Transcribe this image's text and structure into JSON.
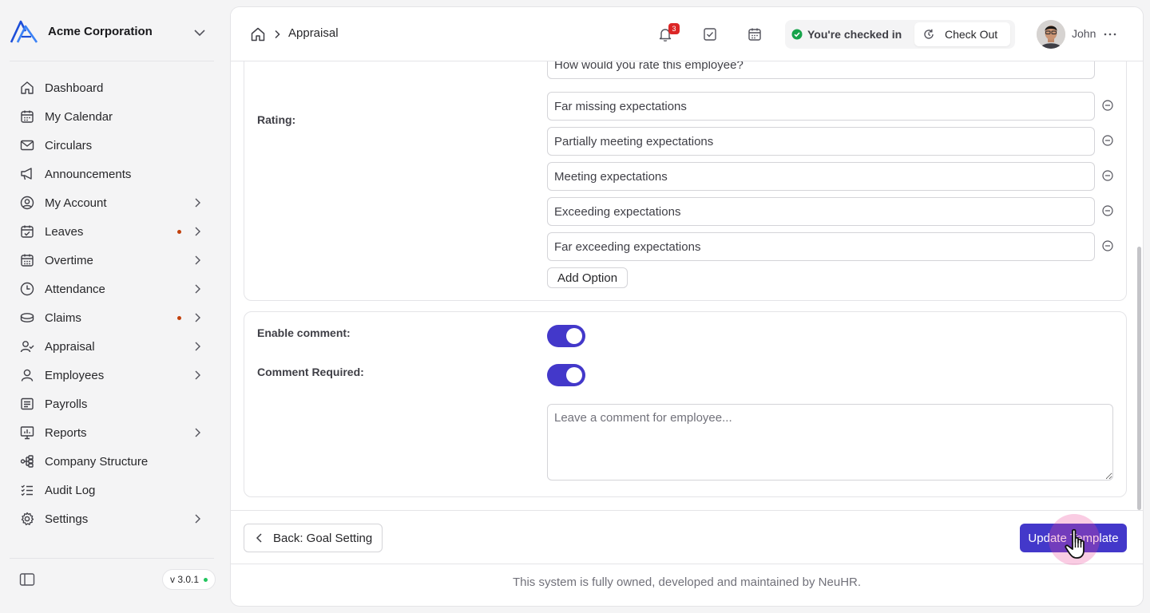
{
  "org": {
    "name": "Acme Corporation"
  },
  "sidebar": {
    "items": [
      {
        "label": "Dashboard",
        "icon": "home-icon",
        "chevron": false,
        "dot": false
      },
      {
        "label": "My Calendar",
        "icon": "calendar-icon",
        "chevron": false,
        "dot": false
      },
      {
        "label": "Circulars",
        "icon": "mail-icon",
        "chevron": false,
        "dot": false
      },
      {
        "label": "Announcements",
        "icon": "megaphone-icon",
        "chevron": false,
        "dot": false
      },
      {
        "label": "My Account",
        "icon": "user-circle-icon",
        "chevron": true,
        "dot": false
      },
      {
        "label": "Leaves",
        "icon": "calendar-check-icon",
        "chevron": true,
        "dot": true
      },
      {
        "label": "Overtime",
        "icon": "calendar-grid-icon",
        "chevron": true,
        "dot": false
      },
      {
        "label": "Attendance",
        "icon": "clock-icon",
        "chevron": true,
        "dot": false
      },
      {
        "label": "Claims",
        "icon": "coins-icon",
        "chevron": true,
        "dot": true
      },
      {
        "label": "Appraisal",
        "icon": "user-check-icon",
        "chevron": true,
        "dot": false
      },
      {
        "label": "Employees",
        "icon": "user-icon",
        "chevron": true,
        "dot": false
      },
      {
        "label": "Payrolls",
        "icon": "receipt-icon",
        "chevron": false,
        "dot": false
      },
      {
        "label": "Reports",
        "icon": "presentation-chart-icon",
        "chevron": true,
        "dot": false
      },
      {
        "label": "Company Structure",
        "icon": "hierarchy-icon",
        "chevron": false,
        "dot": false
      },
      {
        "label": "Audit Log",
        "icon": "checklist-icon",
        "chevron": false,
        "dot": false
      },
      {
        "label": "Settings",
        "icon": "gear-icon",
        "chevron": true,
        "dot": false
      }
    ],
    "version": "v 3.0.1"
  },
  "header": {
    "breadcrumb": "Appraisal",
    "notification_count": "3",
    "check_status": "You're checked in",
    "check_out_label": "Check Out",
    "user_name": "John"
  },
  "form": {
    "question_value": "How would you rate this employee?",
    "rating_label": "Rating:",
    "rating_options": [
      "Far missing expectations",
      "Partially meeting expectations",
      "Meeting expectations",
      "Exceeding expectations",
      "Far exceeding expectations"
    ],
    "add_option_label": "Add Option",
    "enable_comment_label": "Enable comment:",
    "enable_comment_on": true,
    "comment_required_label": "Comment Required:",
    "comment_required_on": true,
    "comment_placeholder": "Leave a comment for employee..."
  },
  "actions": {
    "back_label": "Back: Goal Setting",
    "update_label": "Update Template"
  },
  "footer": {
    "note": "This system is fully owned, developed and maintained by NeuHR."
  },
  "colors": {
    "accent": "#4338ca",
    "badge": "#dc2626",
    "status_ok": "#16a34a",
    "nav_dot": "#c2410c"
  }
}
